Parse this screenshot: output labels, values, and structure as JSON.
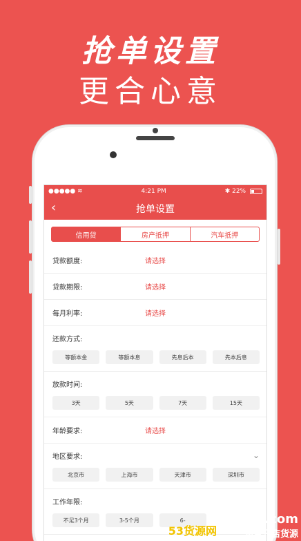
{
  "headline": {
    "line1": "抢单设置",
    "line2": "更合心意"
  },
  "status": {
    "carrier": "●●●●● ≋",
    "time": "4:21 PM",
    "battery": "22%",
    "bt": "✱"
  },
  "nav": {
    "title": "抢单设置",
    "back": "‹"
  },
  "tabs": [
    "信用贷",
    "房产抵押",
    "汽车抵押"
  ],
  "rows": [
    {
      "label": "贷款额度:",
      "value": "请选择"
    },
    {
      "label": "贷款期限:",
      "value": "请选择"
    },
    {
      "label": "每月利率:",
      "value": "请选择"
    }
  ],
  "repay": {
    "label": "还款方式:",
    "options": [
      "等额本金",
      "等额本息",
      "先息后本",
      "先本后息"
    ]
  },
  "loanTime": {
    "label": "放款时间:",
    "options": [
      "3天",
      "5天",
      "7天",
      "15天"
    ]
  },
  "age": {
    "label": "年龄要求:",
    "value": "请选择"
  },
  "region": {
    "label": "地区要求:",
    "options": [
      "北京市",
      "上海市",
      "天津市",
      "深圳市"
    ],
    "chevron": "⌄"
  },
  "work": {
    "label": "工作年限:",
    "options": [
      "不足3个月",
      "3-5个月",
      "6-"
    ]
  },
  "watermark": {
    "cn": "53货源网",
    "site": "53shop.com",
    "slogan": "淘宝开店货源"
  },
  "colors": {
    "accent": "#e84e4c",
    "background": "#ec5350"
  }
}
